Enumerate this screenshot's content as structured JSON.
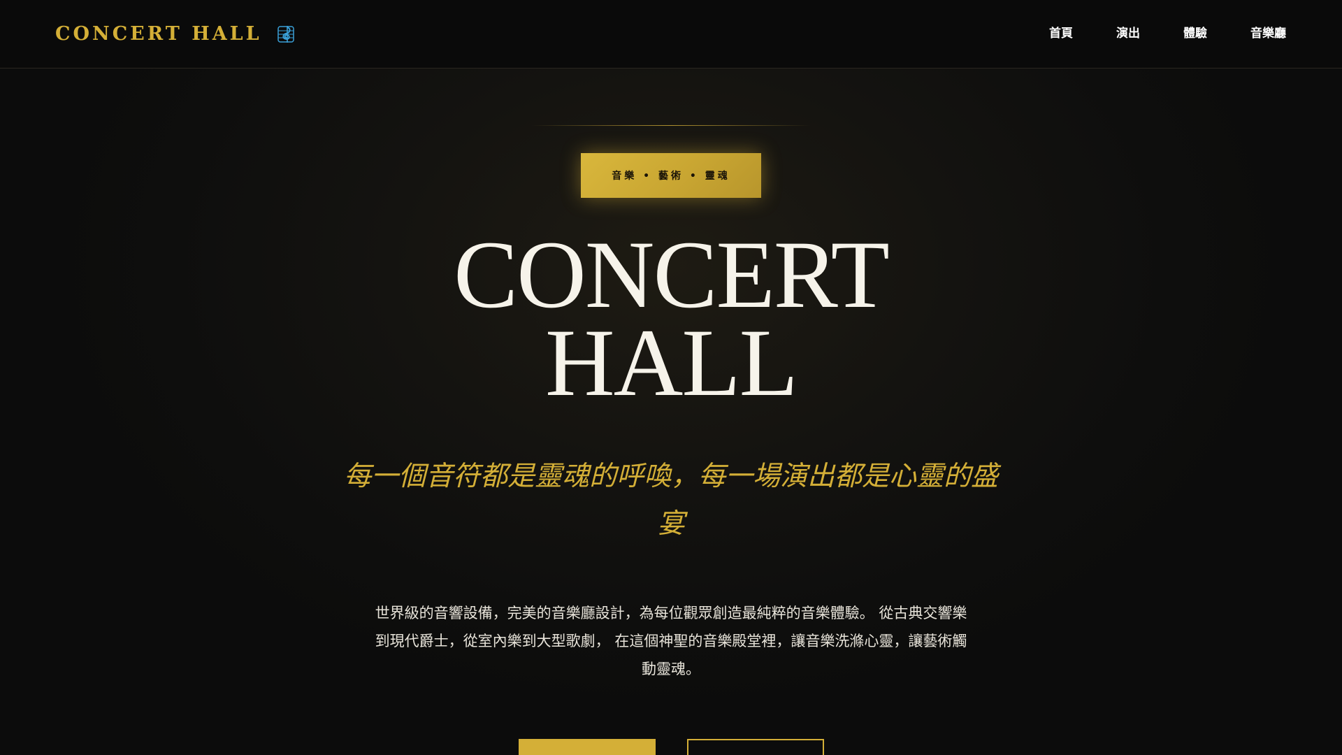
{
  "header": {
    "brand": "CONCERT HALL",
    "brand_icon": "music-note-icon",
    "nav": [
      {
        "label": "首頁"
      },
      {
        "label": "演出"
      },
      {
        "label": "體驗"
      },
      {
        "label": "音樂廳"
      }
    ]
  },
  "hero": {
    "tagline": "音樂 • 藝術 • 靈魂",
    "title_line1": "CONCERT",
    "title_line2": "HALL",
    "subtitle": "每一個音符都是靈魂的呼喚，每一場演出都是心靈的盛宴",
    "description": "世界級的音響設備，完美的音樂廳設計，為每位觀眾創造最純粹的音樂體驗。 從古典交響樂到現代爵士，從室內樂到大型歌劇， 在這個神聖的音樂殿堂裡，讓音樂洗滌心靈，讓藝術觸動靈魂。"
  },
  "colors": {
    "accent": "#d4af37",
    "background": "#0d0d0d",
    "text": "#f6f3ea",
    "nav_icon": "#3aa0d8"
  }
}
